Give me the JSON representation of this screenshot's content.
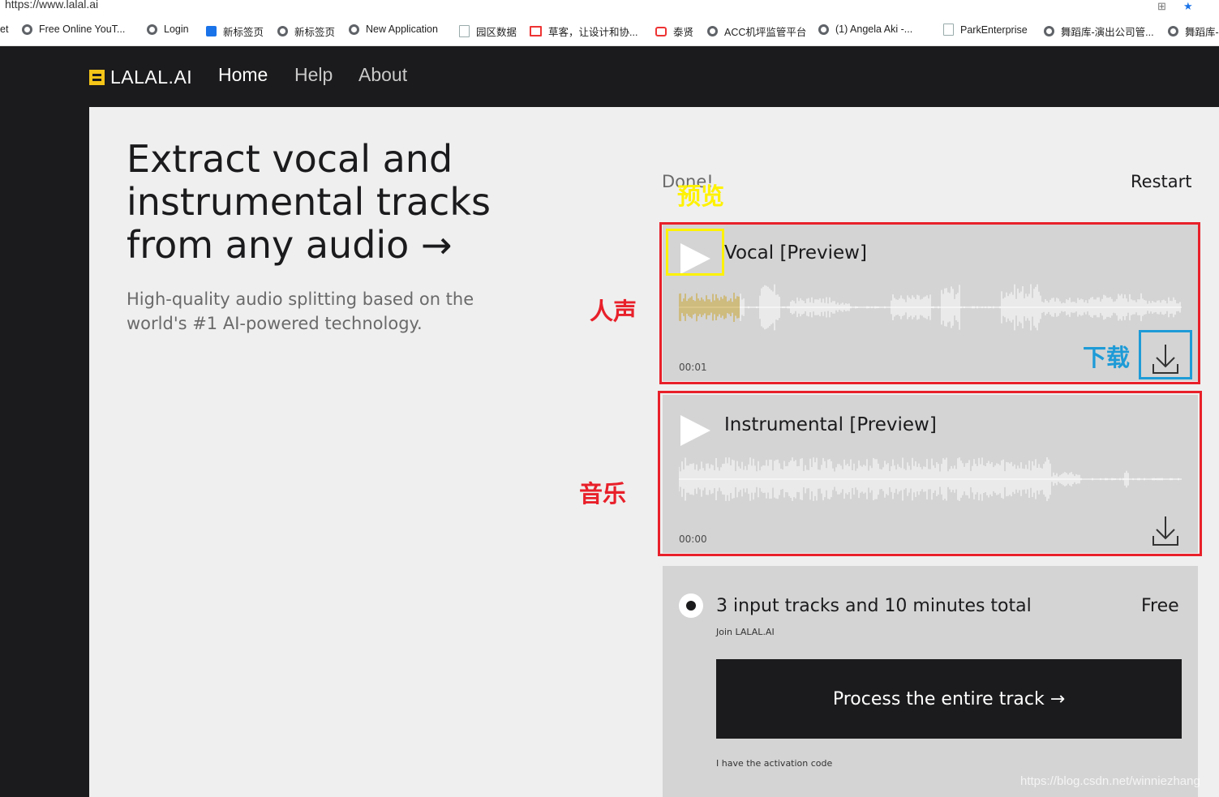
{
  "browser": {
    "url": "https://www.lalal.ai",
    "bookmarks": [
      {
        "label": "et",
        "icon": "none"
      },
      {
        "label": "Free Online YouT...",
        "icon": "globe-icon"
      },
      {
        "label": "Login",
        "icon": "globe-icon"
      },
      {
        "label": "新标签页",
        "icon": "app-icon"
      },
      {
        "label": "新标签页",
        "icon": "globe-icon"
      },
      {
        "label": "New Application",
        "icon": "globe-icon"
      },
      {
        "label": "园区数据",
        "icon": "doc-icon"
      },
      {
        "label": "草客，让设计和协...",
        "icon": "mail-icon"
      },
      {
        "label": "泰贤",
        "icon": "red-icon"
      },
      {
        "label": "ACC机坪监管平台",
        "icon": "globe-icon"
      },
      {
        "label": "(1) Angela Aki -...",
        "icon": "globe-icon"
      },
      {
        "label": "ParkEnterprise",
        "icon": "doc-icon"
      },
      {
        "label": "舞蹈库-演出公司管...",
        "icon": "globe-icon"
      },
      {
        "label": "舞蹈库-",
        "icon": "globe-icon"
      }
    ]
  },
  "header": {
    "logo": "LALAL.AI",
    "nav": [
      "Home",
      "Help",
      "About"
    ]
  },
  "hero": {
    "title": "Extract vocal and instrumental tracks from any audio →",
    "subtitle": "High-quality audio splitting based on the world's #1 AI-powered technology."
  },
  "panel": {
    "status": "Done!",
    "restart": "Restart",
    "tracks": [
      {
        "title": "Vocal [Preview]",
        "time": "00:01",
        "progress": 0.12
      },
      {
        "title": "Instrumental [Preview]",
        "time": "00:00",
        "progress": 0
      }
    ]
  },
  "plan": {
    "label": "3 input tracks and 10 minutes total",
    "price": "Free",
    "join": "Join LALAL.AI",
    "button": "Process the entire track →",
    "activation": "I have the activation code"
  },
  "annotations": {
    "preview": "预览",
    "vocal": "人声",
    "download": "下载",
    "music": "音乐",
    "colors": {
      "red": "#e8202a",
      "yellow": "#fff200",
      "blue": "#1e9bd7"
    }
  },
  "watermark": "https://blog.csdn.net/winniezhang"
}
